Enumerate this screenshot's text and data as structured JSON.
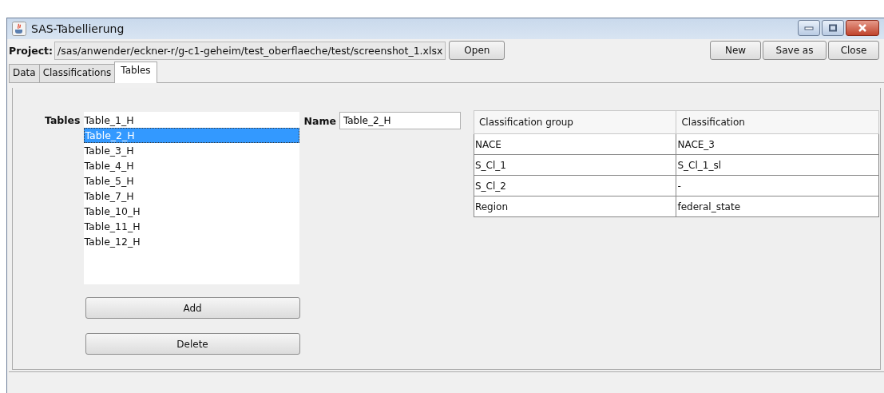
{
  "window": {
    "title": "SAS-Tabellierung"
  },
  "project": {
    "label": "Project:",
    "path": "/sas/anwender/eckner-r/g-c1-geheim/test_oberflaeche/test/screenshot_1.xlsx",
    "open_button": "Open"
  },
  "toolbar_buttons": [
    "New",
    "Save as",
    "Close"
  ],
  "tabs": [
    {
      "label": "Data",
      "selected": false
    },
    {
      "label": "Classifications",
      "selected": false
    },
    {
      "label": "Tables",
      "selected": true
    }
  ],
  "tables": {
    "label": "Tables",
    "items": [
      {
        "label": "Table_1_H",
        "selected": false
      },
      {
        "label": "Table_2_H",
        "selected": true
      },
      {
        "label": "Table_3_H",
        "selected": false
      },
      {
        "label": "Table_4_H",
        "selected": false
      },
      {
        "label": "Table_5_H",
        "selected": false
      },
      {
        "label": "Table_7_H",
        "selected": false
      },
      {
        "label": "Table_10_H",
        "selected": false
      },
      {
        "label": "Table_11_H",
        "selected": false
      },
      {
        "label": "Table_12_H",
        "selected": false
      }
    ],
    "add_button": "Add",
    "delete_button": "Delete"
  },
  "name": {
    "label": "Name",
    "value": "Table_2_H"
  },
  "table": {
    "columns": [
      "Classification group",
      "Classification"
    ],
    "rows": [
      [
        "NACE",
        "NACE_3"
      ],
      [
        "S_Cl_1",
        "S_Cl_1_sl"
      ],
      [
        "S_Cl_2",
        "-"
      ],
      [
        "Region",
        "federal_state"
      ]
    ]
  }
}
